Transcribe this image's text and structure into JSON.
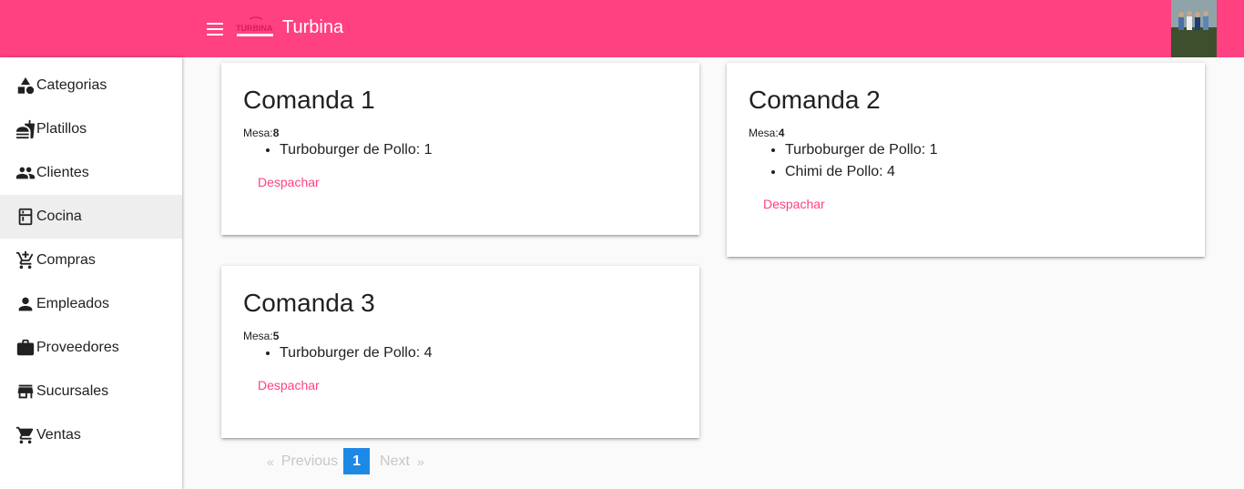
{
  "app": {
    "title": "Turbina",
    "logo_text": "TURBINA",
    "brand_color": "#ff4081",
    "icons": {
      "menu": "hamburger-icon",
      "avatar": "user-avatar-photo"
    }
  },
  "sidebar": {
    "items": [
      {
        "label": "Categorias",
        "icon": "category-shapes-icon",
        "active": false
      },
      {
        "label": "Platillos",
        "icon": "food-dishes-icon",
        "active": false
      },
      {
        "label": "Clientes",
        "icon": "people-icon",
        "active": false
      },
      {
        "label": "Cocina",
        "icon": "kitchen-icon",
        "active": true
      },
      {
        "label": "Compras",
        "icon": "add-shopping-cart-icon",
        "active": false
      },
      {
        "label": "Empleados",
        "icon": "person-icon",
        "active": false
      },
      {
        "label": "Proveedores",
        "icon": "work-briefcase-icon",
        "active": false
      },
      {
        "label": "Sucursales",
        "icon": "store-icon",
        "active": false
      },
      {
        "label": "Ventas",
        "icon": "shopping-cart-icon",
        "active": false
      }
    ]
  },
  "orders": [
    {
      "title": "Comanda 1",
      "mesa_label": "Mesa:",
      "mesa": "8",
      "items": [
        "Turboburger de Pollo: 1"
      ],
      "action": "Despachar"
    },
    {
      "title": "Comanda 2",
      "mesa_label": "Mesa:",
      "mesa": "4",
      "items": [
        "Turboburger de Pollo: 1",
        "Chimi de Pollo: 4"
      ],
      "action": "Despachar"
    },
    {
      "title": "Comanda 3",
      "mesa_label": "Mesa:",
      "mesa": "5",
      "items": [
        "Turboburger de Pollo: 4"
      ],
      "action": "Despachar"
    }
  ],
  "pagination": {
    "first": "«",
    "previous": "Previous",
    "current": "1",
    "next": "Next",
    "last": "»",
    "active_color": "#1e88e5"
  }
}
